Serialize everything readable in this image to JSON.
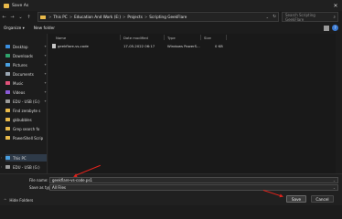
{
  "window": {
    "title": "Save As",
    "close_glyph": "✕"
  },
  "nav": {
    "back_glyph": "←",
    "forward_glyph": "→",
    "recent_glyph": "⌄",
    "up_glyph": "↑",
    "breadcrumbs": [
      {
        "label": "This PC"
      },
      {
        "label": "Education And Work (E:)"
      },
      {
        "label": "Projects"
      },
      {
        "label": "Scripting GeekFlare"
      }
    ],
    "separator": ">",
    "dropdown_glyph": "⌄",
    "refresh_glyph": "↻",
    "search_placeholder": "Search Scripting GeekFlare",
    "search_glyph": "⌕"
  },
  "toolbar": {
    "organize_label": "Organize ▾",
    "new_folder_label": "New folder",
    "help_glyph": "?"
  },
  "sidebar": {
    "items": [
      {
        "label": "Desktop",
        "icon": "desktop-icon",
        "color": "#3b8fe0",
        "pinned": true
      },
      {
        "label": "Downloads",
        "icon": "download-icon",
        "color": "#2fa36b",
        "pinned": true
      },
      {
        "label": "Pictures",
        "icon": "pictures-icon",
        "color": "#4aa0e0",
        "pinned": true
      },
      {
        "label": "Documents",
        "icon": "documents-icon",
        "color": "#9aa6b2",
        "pinned": true
      },
      {
        "label": "Music",
        "icon": "music-icon",
        "color": "#e0527a",
        "pinned": true
      },
      {
        "label": "Videos",
        "icon": "videos-icon",
        "color": "#8a5ad6",
        "pinned": true
      },
      {
        "label": "EDU - USB (G:)",
        "icon": "drive-icon",
        "color": "#9a9a9a",
        "pinned": true
      },
      {
        "label": "Find zerobyte s",
        "icon": "folder-icon",
        "color": "#e8b94a",
        "pinned": false
      },
      {
        "label": "gkbubbles",
        "icon": "folder-icon",
        "color": "#e8b94a",
        "pinned": false
      },
      {
        "label": "Grep search fo",
        "icon": "folder-icon",
        "color": "#e8b94a",
        "pinned": false
      },
      {
        "label": "PowerShell Scrip",
        "icon": "folder-icon",
        "color": "#e8b94a",
        "pinned": false
      },
      {
        "label": "This PC",
        "icon": "pc-icon",
        "color": "#4aa0e0",
        "pinned": false,
        "expand": true
      },
      {
        "label": "EDU - USB (G:)",
        "icon": "drive-icon",
        "color": "#9a9a9a",
        "pinned": false,
        "expand": true
      }
    ],
    "pin_glyph": "✦",
    "expand_glyph": "›"
  },
  "files": {
    "columns": [
      "Name",
      "Date modified",
      "Type",
      "Size"
    ],
    "rows": [
      {
        "name": "geekflare-vs-code",
        "date": "17-05-2022 06:17",
        "type": "Windows PowerS...",
        "size": "0 KB"
      }
    ]
  },
  "bottom": {
    "filename_label": "File name:",
    "filename_value": "geekflare-vs-code.ps1",
    "savetype_label": "Save as type:",
    "savetype_value": "All Files",
    "dropdown_glyph": "⌄",
    "hide_folders_label": "Hide Folders",
    "hide_folders_glyph": "^",
    "save_label": "Save",
    "cancel_label": "Cancel"
  }
}
